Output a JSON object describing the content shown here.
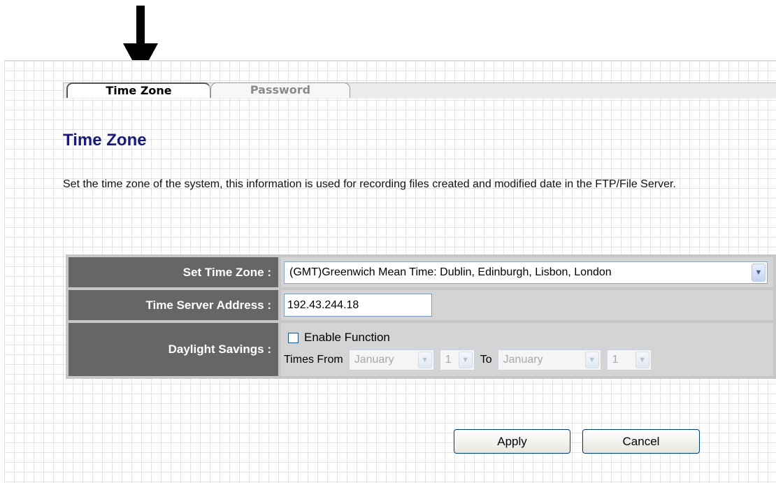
{
  "tabs": [
    {
      "label": "Time Zone"
    },
    {
      "label": "Password"
    }
  ],
  "page_title": "Time Zone",
  "description": "Set the time zone of the system, this information is used for recording files created and modified date in the FTP/File Server.",
  "form": {
    "time_zone": {
      "label": "Set Time Zone :",
      "value": "(GMT)Greenwich Mean Time: Dublin, Edinburgh, Lisbon, London"
    },
    "time_server": {
      "label": "Time Server Address :",
      "value": "192.43.244.18"
    },
    "daylight": {
      "label": "Daylight Savings :",
      "enable_label": "Enable Function",
      "times_from_label": "Times From",
      "to_label": "To",
      "from_month": "January",
      "from_day": "1",
      "to_month": "January",
      "to_day": "1"
    }
  },
  "buttons": {
    "apply": "Apply",
    "cancel": "Cancel"
  }
}
